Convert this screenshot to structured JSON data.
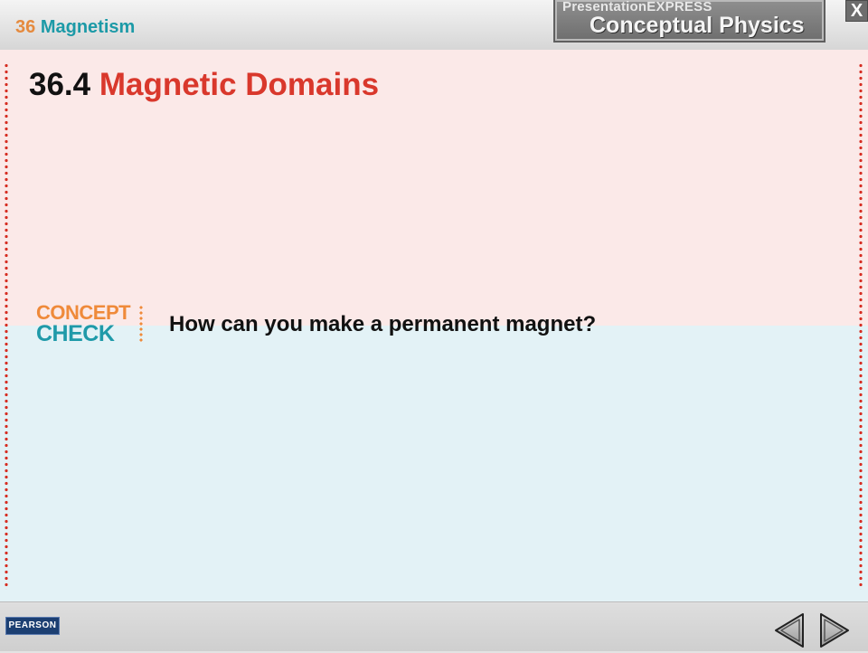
{
  "header": {
    "chapter_number": "36",
    "chapter_title": "Magnetism",
    "brand_prefix": "Presentation",
    "brand_suffix": "EXPRESS",
    "brand_title": "Conceptual Physics",
    "close_label": "X"
  },
  "slide": {
    "section_number": "36.4",
    "section_title": "Magnetic Domains",
    "concept_label_top": "CONCEPT",
    "concept_label_bottom": "CHECK",
    "question": "How can you make a permanent magnet?"
  },
  "footer": {
    "publisher": "PEARSON",
    "prev_icon": "previous-arrow-icon",
    "next_icon": "next-arrow-icon"
  },
  "colors": {
    "accent_red": "#d9382c",
    "teal": "#1c9aa7",
    "orange": "#e58a3e",
    "upper_bg": "#fbe9e8",
    "lower_bg": "#e3f2f6"
  }
}
